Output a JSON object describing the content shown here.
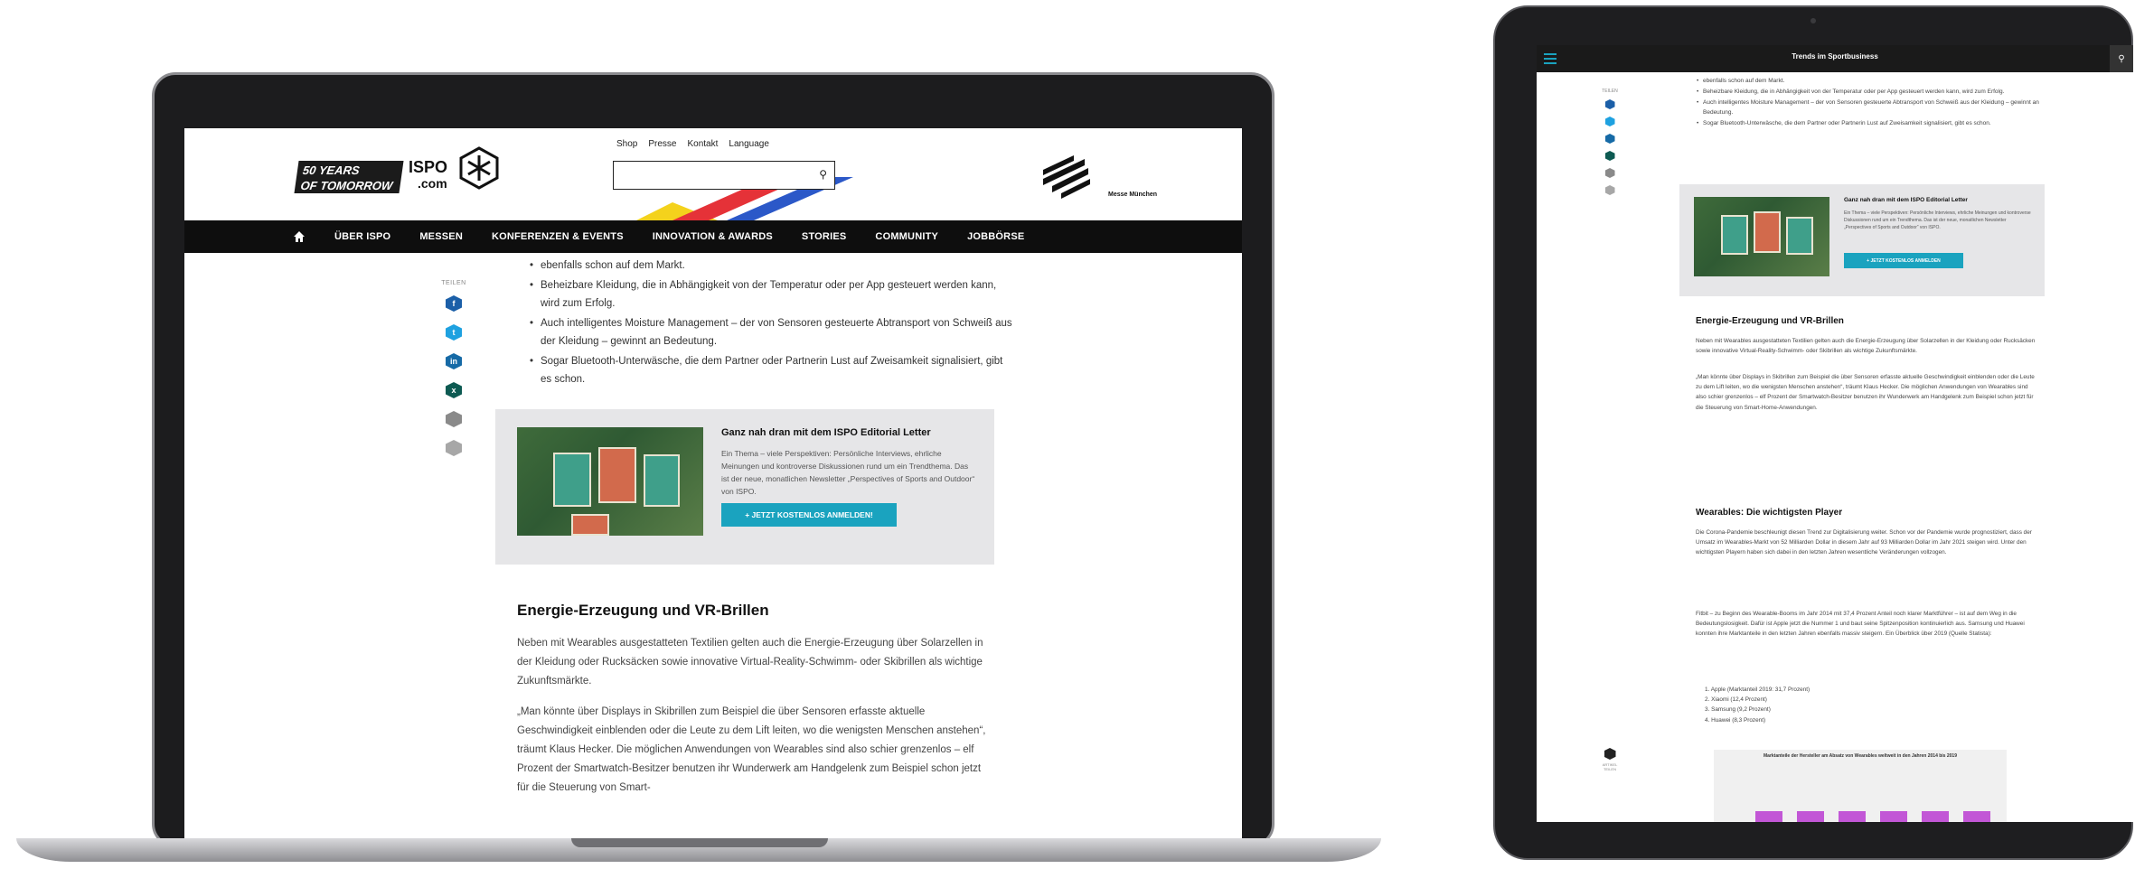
{
  "laptop": {
    "logo": {
      "line1": "50 YEARS",
      "line2": "OF TOMORROW",
      "brand": "ISPO",
      "brand_sub": ".com",
      "partner": "Messe München"
    },
    "top_links": [
      "Shop",
      "Presse",
      "Kontakt",
      "Language"
    ],
    "nav": [
      "ÜBER ISPO",
      "MESSEN",
      "KONFERENZEN & EVENTS",
      "INNOVATION & AWARDS",
      "STORIES",
      "COMMUNITY",
      "JOBBÖRSE"
    ],
    "share_label": "TEILEN",
    "bullets": [
      "ebenfalls schon auf dem Markt.",
      "Beheizbare Kleidung, die in Abhängigkeit von der Temperatur oder per App gesteuert werden kann, wird zum Erfolg.",
      "Auch intelligentes Moisture Management – der von Sensoren gesteuerte Abtransport von Schweiß aus der Kleidung – gewinnt an Bedeutung.",
      "Sogar Bluetooth-Unterwäsche, die dem Partner oder Partnerin Lust auf Zweisamkeit signalisiert, gibt es schon."
    ],
    "promo": {
      "title": "Ganz nah dran mit dem ISPO Editorial Letter",
      "text": "Ein Thema – viele Perspektiven: Persönliche Interviews, ehrliche Meinungen und kontroverse Diskussionen rund um ein Trendthema. Das ist der neue, monatlichen Newsletter „Perspectives of Sports and Outdoor“ von ISPO.",
      "button": "+ JETZT KOSTENLOS ANMELDEN!"
    },
    "heading": "Energie-Erzeugung und VR-Brillen",
    "para1": "Neben mit Wearables ausgestatteten Textilien gelten auch die Energie-Erzeugung über Solarzellen in der Kleidung oder Rucksäcken sowie innovative Virtual-Reality-Schwimm- oder Skibrillen als wichtige Zukunftsmärkte.",
    "para2": "„Man könnte über Displays in Skibrillen zum Beispiel die über Sensoren erfasste aktuelle Geschwindigkeit einblenden oder die Leute zu dem Lift leiten, wo die wenigsten Menschen anstehen“, träumt Klaus Hecker. Die möglichen Anwendungen von Wearables sind also schier grenzenlos – elf Prozent der Smartwatch-Besitzer benutzen ihr Wunderwerk am Handgelenk zum Beispiel schon jetzt für die Steuerung von Smart-"
  },
  "tablet": {
    "title": "Trends im Sportbusiness",
    "share_label": "TEILEN",
    "bullets": [
      "ebenfalls schon auf dem Markt.",
      "Beheizbare Kleidung, die in Abhängigkeit von der Temperatur oder per App gesteuert werden kann, wird zum Erfolg.",
      "Auch intelligentes Moisture Management – der von Sensoren gesteuerte Abtransport von Schweiß aus der Kleidung – gewinnt an Bedeutung.",
      "Sogar Bluetooth-Unterwäsche, die dem Partner oder Partnerin Lust auf Zweisamkeit signalisiert, gibt es schon."
    ],
    "promo": {
      "title": "Ganz nah dran mit dem ISPO Editorial Letter",
      "text": "Ein Thema – viele Perspektiven: Persönliche Interviews, ehrliche Meinungen und kontroverse Diskussionen rund um ein Trendthema. Das ist der neue, monatlichen Newsletter „Perspectives of Sports and Outdoor“ von ISPO.",
      "button": "+ JETZT KOSTENLOS ANMELDEN"
    },
    "heading1": "Energie-Erzeugung und VR-Brillen",
    "p1": "Neben mit Wearables ausgestatteten Textilien gelten auch die Energie-Erzeugung über Solarzellen in der Kleidung oder Rucksäcken sowie innovative Virtual-Reality-Schwimm- oder Skibrillen als wichtige Zukunftsmärkte.",
    "p2": "„Man könnte über Displays in Skibrillen zum Beispiel die über Sensoren erfasste aktuelle Geschwindigkeit einblenden oder die Leute zu dem Lift leiten, wo die wenigsten Menschen anstehen“, träumt Klaus Hecker. Die möglichen Anwendungen von Wearables sind also schier grenzenlos – elf Prozent der Smartwatch-Besitzer benutzen ihr Wunderwerk am Handgelenk zum Beispiel schon jetzt für die Steuerung von Smart-Home-Anwendungen.",
    "heading2": "Wearables: Die wichtigsten Player",
    "p3": "Die Corona-Pandemie beschleunigt diesen Trend zur Digitalisierung weiter. Schon vor der Pandemie wurde prognostiziert, dass der Umsatz im Wearables-Markt von 52 Milliarden Dollar in diesem Jahr auf 93 Milliarden Dollar im Jahr 2021 steigen wird. Unter den wichtigsten Playern haben sich dabei in den letzten Jahren wesentliche Veränderungen vollzogen.",
    "p4": "Fitbit – zu Beginn des Wearable-Booms im Jahr 2014 mit 37,4 Prozent Anteil noch klarer Marktführer – ist auf dem Weg in die Bedeutungslosigkeit. Dafür ist Apple jetzt die Nummer 1 und baut seine Spitzenposition kontinuierlich aus. Samsung und Huawei konnten ihre Marktanteile in den letzten Jahren ebenfalls massiv steigern. Ein Überblick über 2019 (Quelle Statista):",
    "ranking": [
      "1. Apple (Marktanteil 2019: 31,7 Prozent)",
      "2. Xiaomi (12,4 Prozent)",
      "3. Samsung (9,2 Prozent)",
      "4. Huawei (8,3 Prozent)"
    ],
    "chart_title": "Marktanteile der Hersteller am Absatz von Wearables weltweit in den Jahren 2014 bis 2019",
    "float_label": "ARTIKEL TEILEN"
  },
  "colors": {
    "accent": "#1aa3bf",
    "nav_bg": "#0e0e0e",
    "promo_bg": "#e6e6e8",
    "chart_bar": "#c257d6"
  }
}
